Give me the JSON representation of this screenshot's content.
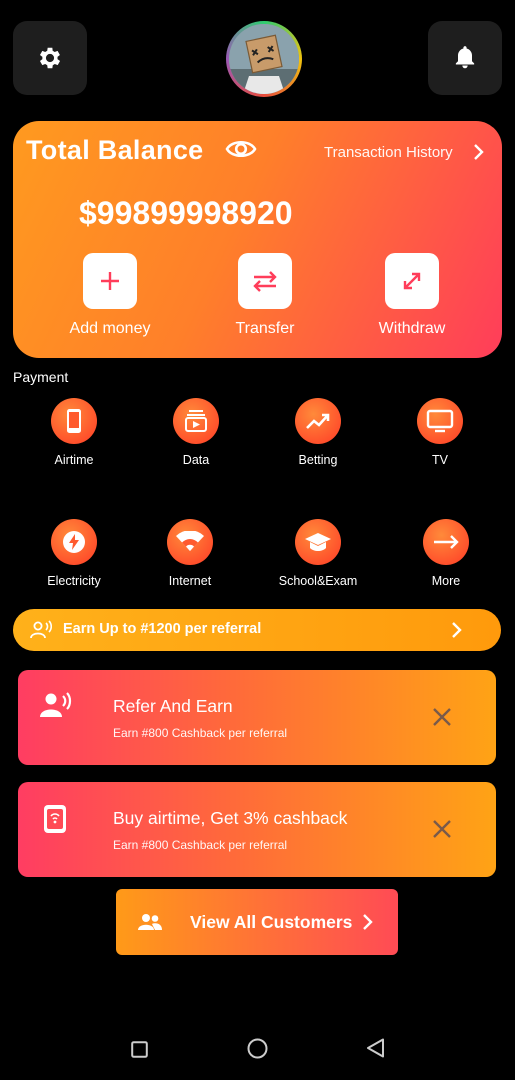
{
  "header": {
    "settings_icon": "gear-icon",
    "notifications_icon": "bell-icon",
    "avatar": "user-avatar"
  },
  "balance": {
    "title": "Total Balance",
    "visibility_icon": "eye-icon",
    "history_link": "Transaction History",
    "amount": "$99899998920",
    "actions": [
      {
        "label": "Add money",
        "icon": "plus-icon"
      },
      {
        "label": "Transfer",
        "icon": "swap-arrows-icon"
      },
      {
        "label": "Withdraw",
        "icon": "expand-arrows-icon"
      }
    ],
    "colors": {
      "from": "#ff9a1f",
      "to": "#ff3d5a"
    }
  },
  "payment": {
    "section_label": "Payment",
    "services": [
      {
        "label": "Airtime",
        "icon": "phone-icon"
      },
      {
        "label": "Data",
        "icon": "data-stack-icon"
      },
      {
        "label": "Betting",
        "icon": "trending-up-icon"
      },
      {
        "label": "TV",
        "icon": "tv-icon"
      },
      {
        "label": "Electricity",
        "icon": "lightning-icon"
      },
      {
        "label": "Internet",
        "icon": "wifi-icon"
      },
      {
        "label": "School&Exam",
        "icon": "graduation-cap-icon"
      },
      {
        "label": "More",
        "icon": "arrow-right-icon"
      }
    ]
  },
  "referral_bar": {
    "text": "Earn Up to #1200 per referral",
    "icon": "speaking-person-icon"
  },
  "promos": [
    {
      "title": "Refer And Earn",
      "subtitle": "Earn #800 Cashback per referral",
      "icon": "speaking-person-icon"
    },
    {
      "title": "Buy airtime, Get 3% cashback",
      "subtitle": "Earn #800 Cashback per referral",
      "icon": "phone-signal-icon"
    }
  ],
  "view_all": {
    "label": "View All Customers",
    "icon": "people-icon"
  },
  "system_nav": {
    "recents": "square-icon",
    "home": "circle-icon",
    "back": "triangle-back-icon"
  }
}
